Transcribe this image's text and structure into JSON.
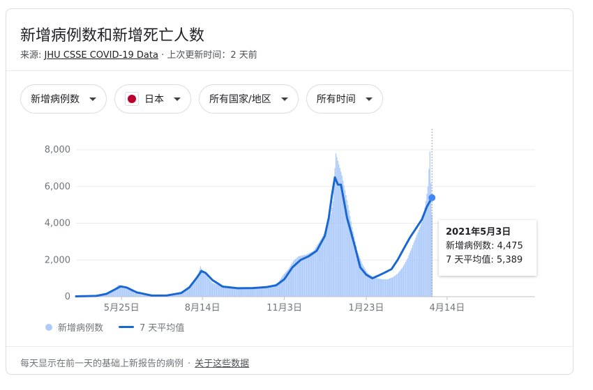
{
  "header": {
    "title": "新增病例数和新增死亡人数",
    "source_prefix": "来源: ",
    "source_link": "JHU CSSE COVID-19 Data",
    "source_suffix": " · 上次更新时间：2 天前"
  },
  "filters": {
    "metric": "新增病例数",
    "country": "日本",
    "region": "所有国家/地区",
    "time": "所有时间"
  },
  "colors": {
    "bars": "#aecbfa",
    "line": "#1967d2",
    "flag": "#bc002d"
  },
  "tooltip": {
    "date": "2021年5月3日",
    "cases_label": "新增病例数: 4,475",
    "avg_label": "7 天平均值: 5,389"
  },
  "legend": {
    "bars": "新增病例数",
    "line": "7 天平均值"
  },
  "footer": {
    "note": "每天显示在前一天的基础上新报告的病例",
    "separator": "·",
    "about": "关于这些数据"
  },
  "chart_data": {
    "type": "bar",
    "title": "",
    "xlabel": "",
    "ylabel": "",
    "ylim": [
      0,
      8000
    ],
    "yticks": [
      "0",
      "2,000",
      "4,000",
      "6,000",
      "8,000"
    ],
    "xticks": [
      "5月25日",
      "8月14日",
      "11月3日",
      "1月23日",
      "4月14日"
    ],
    "xtick_positions": [
      45,
      125,
      206,
      287,
      367
    ],
    "x_total_days": 454,
    "series": [
      {
        "name": "新增病例数",
        "kind": "bars",
        "points": [
          [
            0,
            40
          ],
          [
            10,
            50
          ],
          [
            20,
            60
          ],
          [
            30,
            200
          ],
          [
            38,
            420
          ],
          [
            42,
            640
          ],
          [
            46,
            600
          ],
          [
            52,
            450
          ],
          [
            58,
            200
          ],
          [
            65,
            90
          ],
          [
            75,
            60
          ],
          [
            90,
            80
          ],
          [
            100,
            120
          ],
          [
            108,
            300
          ],
          [
            114,
            600
          ],
          [
            118,
            900
          ],
          [
            121,
            1250
          ],
          [
            123,
            1650
          ],
          [
            125,
            1400
          ],
          [
            129,
            1150
          ],
          [
            135,
            750
          ],
          [
            145,
            550
          ],
          [
            155,
            480
          ],
          [
            165,
            450
          ],
          [
            175,
            450
          ],
          [
            185,
            530
          ],
          [
            195,
            600
          ],
          [
            200,
            780
          ],
          [
            205,
            1200
          ],
          [
            210,
            1500
          ],
          [
            215,
            1950
          ],
          [
            220,
            2200
          ],
          [
            228,
            2300
          ],
          [
            235,
            2500
          ],
          [
            242,
            3100
          ],
          [
            248,
            3700
          ],
          [
            252,
            4500
          ],
          [
            254,
            5200
          ],
          [
            256,
            7000
          ],
          [
            257,
            7800
          ],
          [
            259,
            7400
          ],
          [
            263,
            6600
          ],
          [
            266,
            5800
          ],
          [
            269,
            5000
          ],
          [
            273,
            3800
          ],
          [
            278,
            2500
          ],
          [
            283,
            1800
          ],
          [
            288,
            1300
          ],
          [
            293,
            1100
          ],
          [
            298,
            1000
          ],
          [
            303,
            950
          ],
          [
            308,
            950
          ],
          [
            313,
            1050
          ],
          [
            318,
            1250
          ],
          [
            323,
            1600
          ],
          [
            328,
            2100
          ],
          [
            333,
            2800
          ],
          [
            338,
            3500
          ],
          [
            343,
            4200
          ],
          [
            346,
            5200
          ],
          [
            348,
            6000
          ],
          [
            350,
            7900
          ],
          [
            352,
            4475
          ]
        ]
      },
      {
        "name": "7 天平均值",
        "kind": "line",
        "points": [
          [
            0,
            20
          ],
          [
            20,
            40
          ],
          [
            30,
            150
          ],
          [
            40,
            440
          ],
          [
            44,
            560
          ],
          [
            50,
            500
          ],
          [
            60,
            230
          ],
          [
            75,
            60
          ],
          [
            90,
            70
          ],
          [
            104,
            200
          ],
          [
            112,
            500
          ],
          [
            119,
            1000
          ],
          [
            124,
            1400
          ],
          [
            128,
            1300
          ],
          [
            135,
            900
          ],
          [
            145,
            550
          ],
          [
            160,
            460
          ],
          [
            175,
            470
          ],
          [
            188,
            520
          ],
          [
            198,
            620
          ],
          [
            206,
            950
          ],
          [
            214,
            1600
          ],
          [
            222,
            2000
          ],
          [
            230,
            2200
          ],
          [
            238,
            2500
          ],
          [
            246,
            3300
          ],
          [
            250,
            4300
          ],
          [
            253,
            5500
          ],
          [
            256,
            6500
          ],
          [
            259,
            6100
          ],
          [
            262,
            6100
          ],
          [
            265,
            5200
          ],
          [
            268,
            4300
          ],
          [
            272,
            3500
          ],
          [
            276,
            2700
          ],
          [
            281,
            1600
          ],
          [
            287,
            1200
          ],
          [
            293,
            1000
          ],
          [
            299,
            1150
          ],
          [
            305,
            1300
          ],
          [
            312,
            1500
          ],
          [
            318,
            2000
          ],
          [
            324,
            2600
          ],
          [
            330,
            3200
          ],
          [
            336,
            3700
          ],
          [
            342,
            4200
          ],
          [
            347,
            4900
          ],
          [
            352,
            5389
          ]
        ]
      }
    ],
    "grid": true,
    "legend_position": "bottom-left"
  }
}
